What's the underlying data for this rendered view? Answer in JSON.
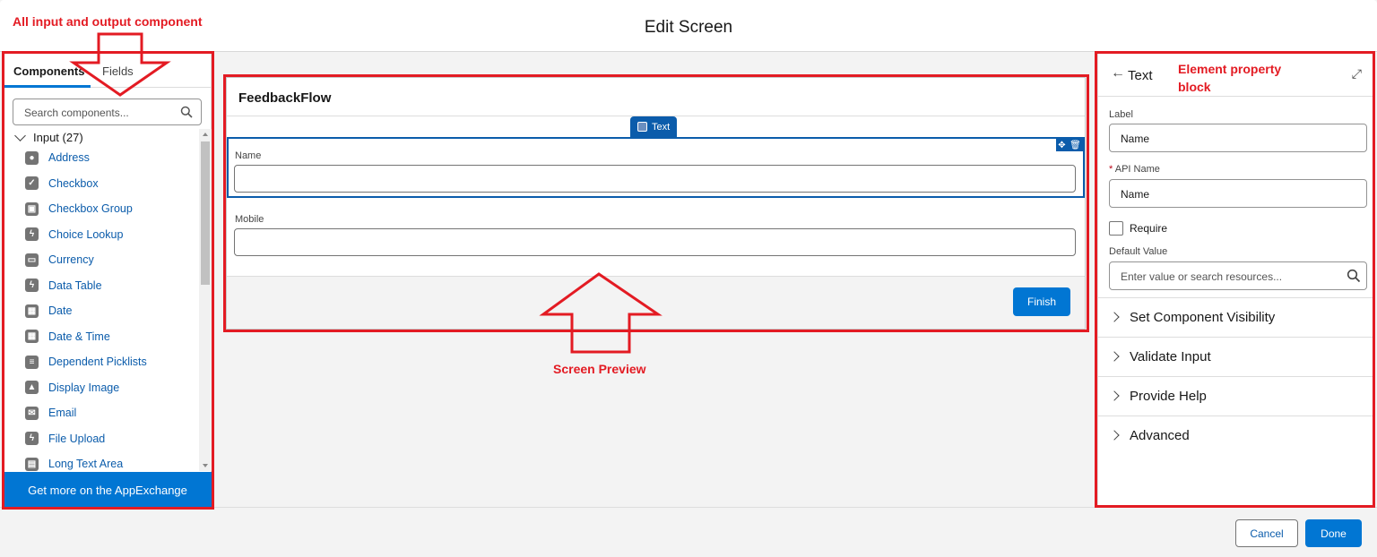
{
  "header": {
    "title": "Edit Screen"
  },
  "left_panel": {
    "tabs": [
      {
        "label": "Components"
      },
      {
        "label": "Fields"
      }
    ],
    "search_placeholder": "Search components...",
    "group": {
      "label": "Input (27)"
    },
    "items": [
      {
        "label": "Address",
        "icon": "location-pin-icon",
        "glyph": "●"
      },
      {
        "label": "Checkbox",
        "icon": "checkbox-icon",
        "glyph": "✓"
      },
      {
        "label": "Checkbox Group",
        "icon": "checkbox-group-icon",
        "glyph": "▣"
      },
      {
        "label": "Choice Lookup",
        "icon": "lightning-icon",
        "glyph": "ϟ"
      },
      {
        "label": "Currency",
        "icon": "currency-icon",
        "glyph": "▭"
      },
      {
        "label": "Data Table",
        "icon": "lightning-icon",
        "glyph": "ϟ"
      },
      {
        "label": "Date",
        "icon": "calendar-icon",
        "glyph": "▦"
      },
      {
        "label": "Date & Time",
        "icon": "calendar-time-icon",
        "glyph": "▦"
      },
      {
        "label": "Dependent Picklists",
        "icon": "list-icon",
        "glyph": "≡"
      },
      {
        "label": "Display Image",
        "icon": "image-icon",
        "glyph": "▲"
      },
      {
        "label": "Email",
        "icon": "email-icon",
        "glyph": "✉"
      },
      {
        "label": "File Upload",
        "icon": "lightning-icon",
        "glyph": "ϟ"
      },
      {
        "label": "Long Text Area",
        "icon": "text-area-icon",
        "glyph": "▤"
      }
    ],
    "appexchange_label": "Get more on the AppExchange"
  },
  "canvas": {
    "flow_title": "FeedbackFlow",
    "selected_tag": "Text",
    "fields": [
      {
        "label": "Name",
        "value": ""
      },
      {
        "label": "Mobile",
        "value": ""
      }
    ],
    "finish_label": "Finish"
  },
  "properties": {
    "title": "Text",
    "label_field": {
      "label": "Label",
      "value": "Name"
    },
    "api_name_field": {
      "required_mark": "*",
      "label": "API Name",
      "value": "Name"
    },
    "require_label": "Require",
    "require_checked": false,
    "default_value": {
      "label": "Default Value",
      "placeholder": "Enter value or search resources..."
    },
    "sections": [
      {
        "label": "Set Component Visibility"
      },
      {
        "label": "Validate Input"
      },
      {
        "label": "Provide Help"
      },
      {
        "label": "Advanced"
      }
    ]
  },
  "footer": {
    "cancel_label": "Cancel",
    "done_label": "Done"
  },
  "annotations": {
    "left": "All input and output component",
    "center": "Screen Preview",
    "right": "Element property block",
    "color": "#e31b23"
  },
  "colors": {
    "brand": "#0176d3",
    "link": "#0b5cab"
  }
}
